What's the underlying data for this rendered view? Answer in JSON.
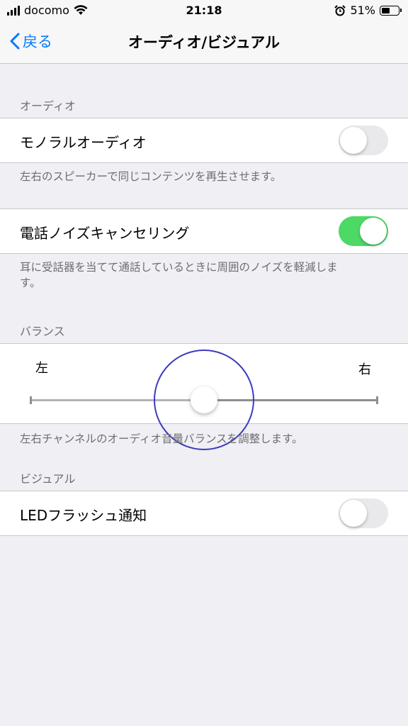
{
  "status": {
    "carrier": "docomo",
    "time": "21:18",
    "battery": "51%",
    "battery_level": 0.51
  },
  "nav": {
    "back_label": "戻る",
    "title": "オーディオ/ビジュアル"
  },
  "audio": {
    "header": "オーディオ",
    "mono_label": "モノラルオーディオ",
    "mono_on": false,
    "mono_note": "左右のスピーカーで同じコンテンツを再生させます。",
    "noise_label": "電話ノイズキャンセリング",
    "noise_on": true,
    "noise_note": "耳に受話器を当てて通話しているときに周囲のノイズを軽減します。"
  },
  "balance": {
    "header": "バランス",
    "left_label": "左",
    "right_label": "右",
    "value": 0.5,
    "note": "左右チャンネルのオーディオ音量バランスを調整します。"
  },
  "visual": {
    "header": "ビジュアル",
    "led_label": "LEDフラッシュ通知",
    "led_on": false
  },
  "colors": {
    "accent": "#007aff",
    "toggle_on": "#4cd964",
    "toggle_off": "#e9e9eb",
    "touch_ring": "#3d3bbf"
  }
}
